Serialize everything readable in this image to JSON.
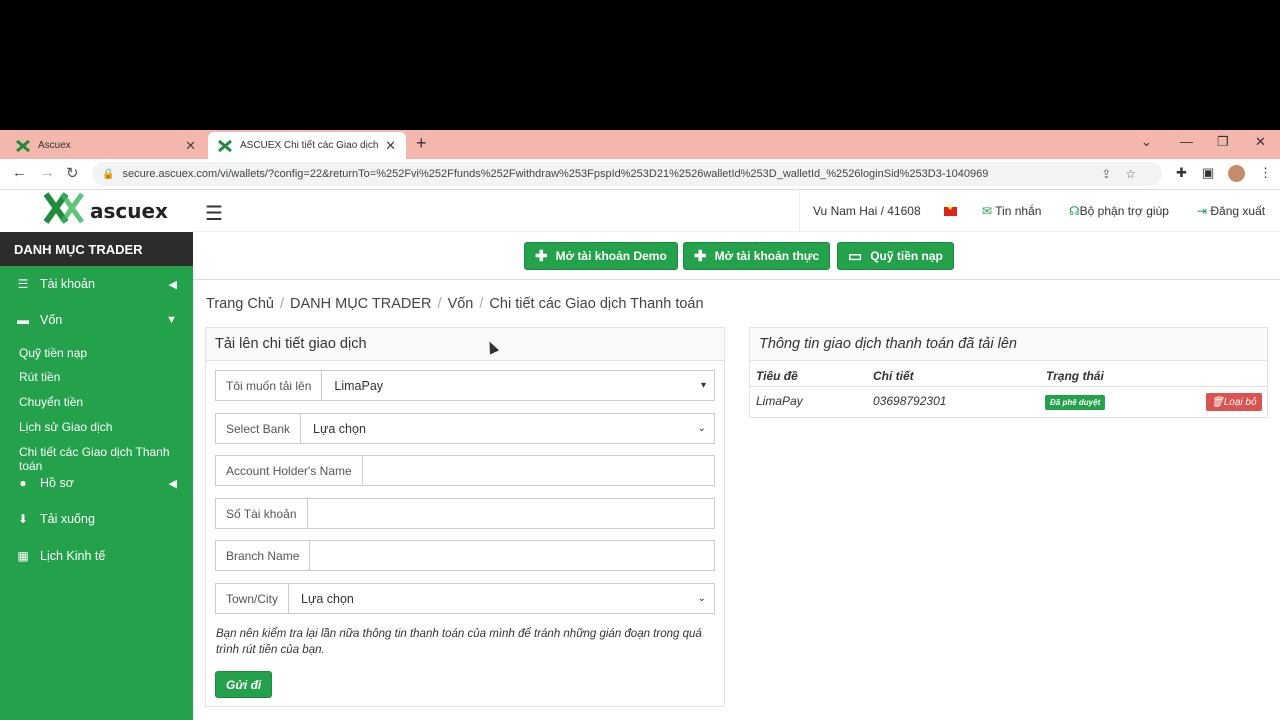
{
  "browser": {
    "tabs": [
      {
        "title": "Ascuex"
      },
      {
        "title": "ASCUEX Chi tiết các Giao dịch Th"
      }
    ],
    "url": "secure.ascuex.com/vi/wallets/?config=22&returnTo=%252Fvi%252Ffunds%252Fwithdraw%253FpspId%253D21%2526walletId%253D_walletId_%2526loginSid%253D3-1040969"
  },
  "logo": {
    "text": "ascuex"
  },
  "sidebar": {
    "heading": "DANH MỤC TRADER",
    "items": [
      {
        "label": "Tài khoản",
        "icon": "list-icon"
      },
      {
        "label": "Vốn",
        "icon": "wallet-icon"
      },
      {
        "label": "Hồ sơ",
        "icon": "user-icon"
      },
      {
        "label": "Tải xuống",
        "icon": "download-icon"
      },
      {
        "label": "Lịch Kinh tế",
        "icon": "calendar-icon"
      }
    ],
    "subitems": [
      "Quỹ tiền nạp",
      "Rút tiền",
      "Chuyển tiền",
      "Lịch sử Giao dịch",
      "Chi tiết các Giao dịch Thanh toán"
    ]
  },
  "topbar": {
    "user": "Vu Nam Hai / 41608",
    "messages": "Tin nhắn",
    "support": "Bộ phận trợ giúp",
    "logout": "Đăng xuất"
  },
  "actions": {
    "demo": "Mở tài khoản Demo",
    "real": "Mở tài khoản thực",
    "deposit": "Quỹ tiền nạp"
  },
  "breadcrumb": [
    "Trang Chủ",
    "DANH MỤC TRADER",
    "Vốn",
    "Chi tiết các Giao dịch Thanh toán"
  ],
  "upload_panel": {
    "title": "Tải lên chi tiết giao dịch",
    "fields": [
      {
        "label": "Tôi muốn tải lên",
        "value": "LimaPay"
      },
      {
        "label": "Select Bank",
        "value": "Lựa chọn"
      },
      {
        "label": "Account Holder's Name",
        "value": ""
      },
      {
        "label": "Số Tài khoản",
        "value": ""
      },
      {
        "label": "Branch Name",
        "value": ""
      },
      {
        "label": "Town/City",
        "value": "Lựa chọn"
      }
    ],
    "note": "Bạn nên kiểm tra lại lần nữa thông tin thanh toán của mình để tránh những gián đoạn trong quá trình rút tiền của bạn.",
    "submit": "Gửi đi"
  },
  "info_panel": {
    "title": "Thông tin giao dịch thanh toán đã tải lên",
    "headers": [
      "Tiêu đề",
      "Chi tiết",
      "Trạng thái"
    ],
    "row": {
      "title": "LimaPay",
      "detail": "03698792301",
      "status": "Đã phê duyệt",
      "action": "Loại bỏ"
    }
  },
  "colors": {
    "brand": "#24a14b",
    "dark": "#2c2c2c",
    "danger": "#d9534f",
    "tabbar": "#f3b7ad"
  }
}
